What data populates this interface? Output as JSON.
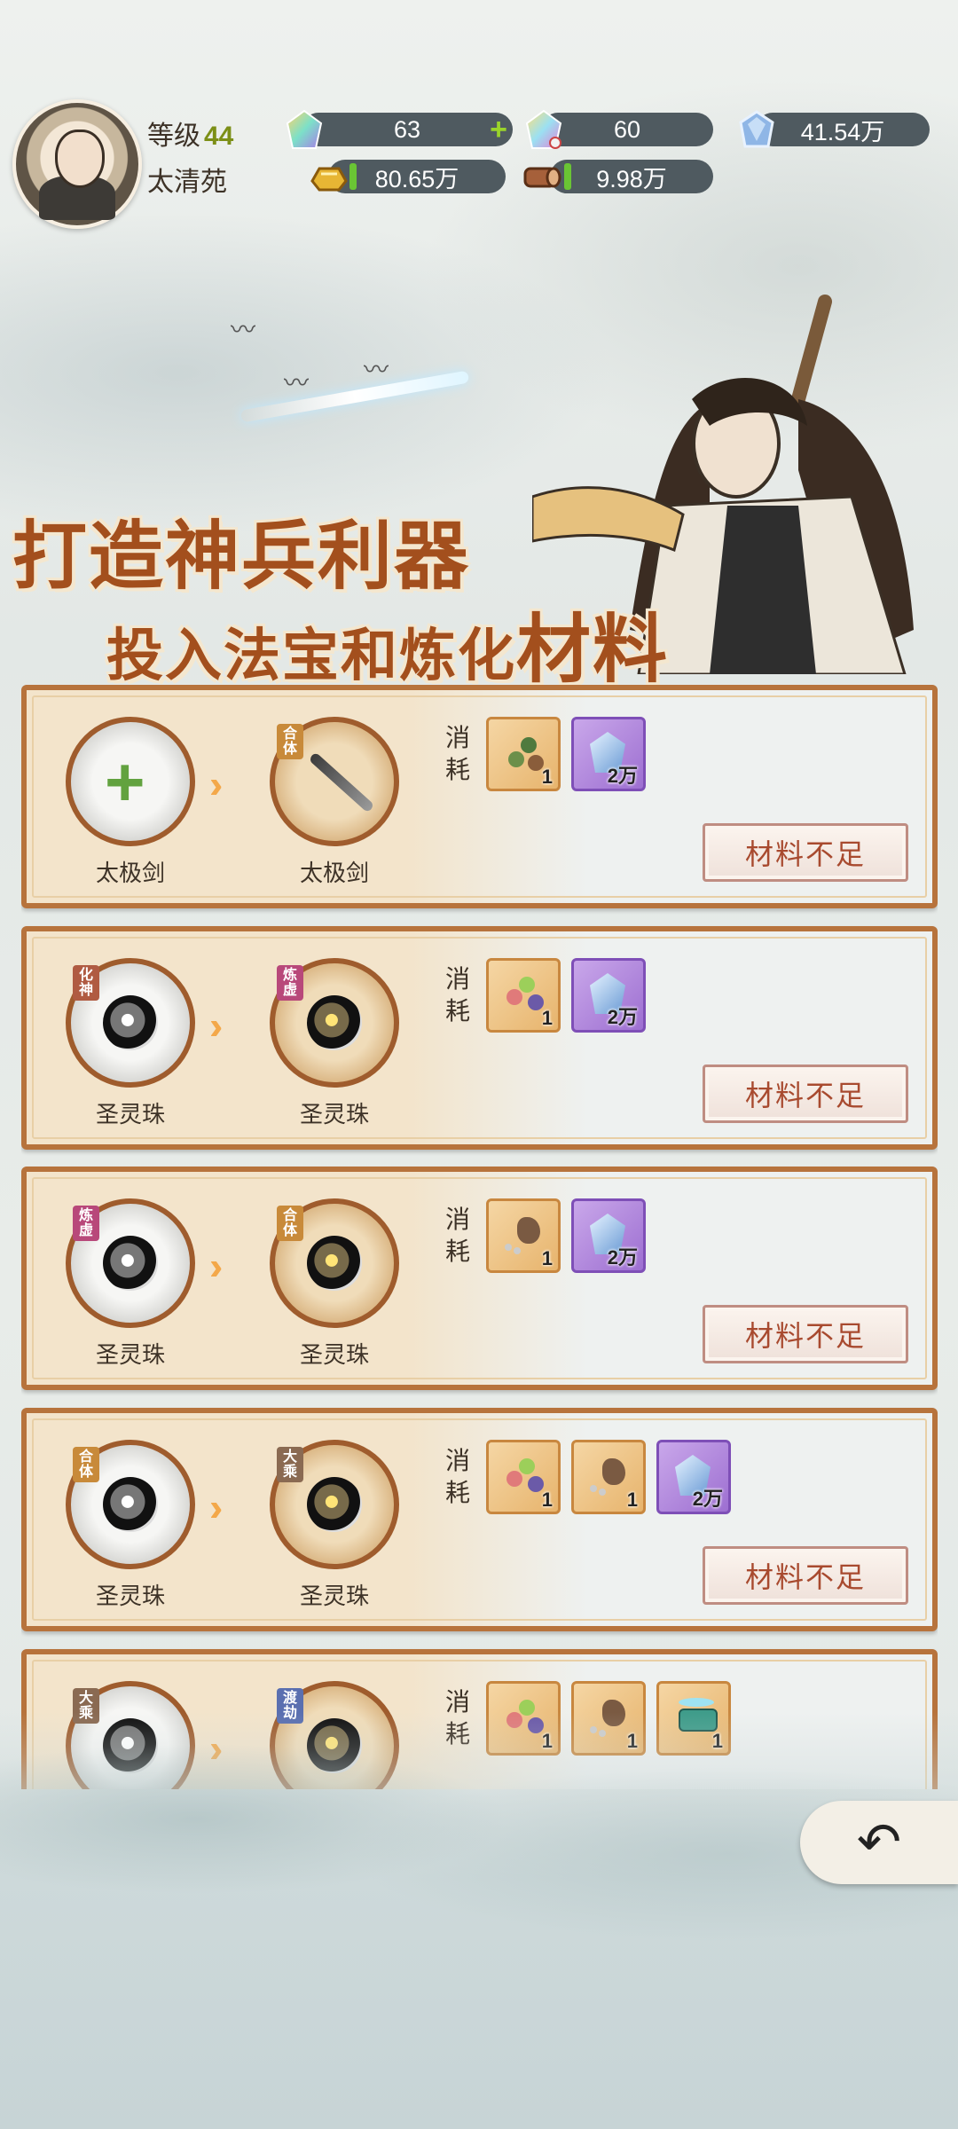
{
  "player": {
    "level_label": "等级",
    "level": "44",
    "name": "太清苑"
  },
  "resources": [
    {
      "icon": "rainbow-crystal-icon",
      "value": "63",
      "has_add": true
    },
    {
      "icon": "rainbow-crystal-alt-icon",
      "value": "60"
    },
    {
      "icon": "blue-crystal-icon",
      "value": "41.54万"
    },
    {
      "icon": "gold-ingot-icon",
      "value": "80.65万"
    },
    {
      "icon": "wood-log-icon",
      "value": "9.98万"
    }
  ],
  "banner": {
    "line1": "打造神兵利器",
    "line2_prefix": "投入法宝和炼化",
    "line2_emphasis": "材料"
  },
  "consume_label": "消耗",
  "recipes": [
    {
      "from": {
        "name": "太极剑",
        "tag": "",
        "kind": "empty"
      },
      "to": {
        "name": "太极剑",
        "tag": "合体",
        "kind": "sword"
      },
      "costs": [
        {
          "type": "mat",
          "icon": "herb-icon",
          "qty": "1"
        },
        {
          "type": "gem",
          "icon": "blue-crystal-icon",
          "qty": "2万"
        }
      ],
      "button": "材料不足"
    },
    {
      "from": {
        "name": "圣灵珠",
        "tag": "化神",
        "kind": "pearl"
      },
      "to": {
        "name": "圣灵珠",
        "tag": "炼虚",
        "kind": "pearl"
      },
      "costs": [
        {
          "type": "mat",
          "icon": "herb-icon",
          "qty": "1"
        },
        {
          "type": "gem",
          "icon": "blue-crystal-icon",
          "qty": "2万"
        }
      ],
      "button": "材料不足"
    },
    {
      "from": {
        "name": "圣灵珠",
        "tag": "炼虚",
        "kind": "pearl"
      },
      "to": {
        "name": "圣灵珠",
        "tag": "合体",
        "kind": "pearl"
      },
      "costs": [
        {
          "type": "mat",
          "icon": "seed-icon",
          "qty": "1"
        },
        {
          "type": "gem",
          "icon": "blue-crystal-icon",
          "qty": "2万"
        }
      ],
      "button": "材料不足"
    },
    {
      "from": {
        "name": "圣灵珠",
        "tag": "合体",
        "kind": "pearl"
      },
      "to": {
        "name": "圣灵珠",
        "tag": "大乘",
        "kind": "pearl"
      },
      "costs": [
        {
          "type": "mat",
          "icon": "herb-icon",
          "qty": "1"
        },
        {
          "type": "mat",
          "icon": "seed-icon",
          "qty": "1"
        },
        {
          "type": "gem",
          "icon": "blue-crystal-icon",
          "qty": "2万"
        }
      ],
      "button": "材料不足"
    },
    {
      "from": {
        "name": "",
        "tag": "大乘",
        "kind": "pearl"
      },
      "to": {
        "name": "",
        "tag": "渡劫",
        "kind": "pearl"
      },
      "costs": [
        {
          "type": "mat",
          "icon": "herb-icon",
          "qty": "1"
        },
        {
          "type": "mat",
          "icon": "seed-icon",
          "qty": "1"
        },
        {
          "type": "mat",
          "icon": "jade-box-icon",
          "qty": "1"
        }
      ],
      "button": ""
    }
  ],
  "back_icon": "return-arrow-icon"
}
